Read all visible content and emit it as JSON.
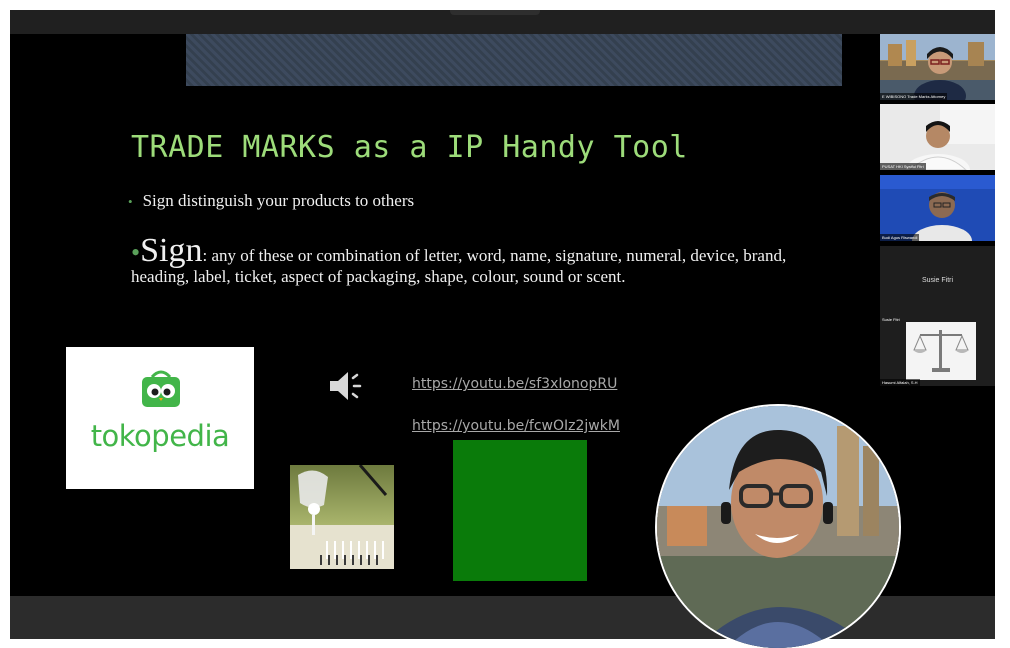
{
  "slide": {
    "title": "TRADE MARKS as a IP Handy Tool",
    "bullet1_marker": "•",
    "bullet1": "Sign distinguish your products to others",
    "bullet2_marker": "•",
    "bullet2_term": "Sign",
    "bullet2_text": ":  any of these or combination of  letter, word, name, signature, numeral, device, brand, heading, label, ticket, aspect of packaging, shape, colour, sound or scent.",
    "logo_text": "tokopedia",
    "link1": "https://youtu.be/sf3xIonopRU",
    "link2": "https://youtu.be/fcwOIz2jwkM",
    "audio_icon": "speaker-icon"
  },
  "participants": [
    {
      "label": "E WIBISONO Trade Marks Attorney"
    },
    {
      "label": "PUSAT HKI Syaiful Fitri"
    },
    {
      "label": "Budi Agus Riswandi"
    },
    {
      "label": "Susie Fitri",
      "center_name": "Susie Fitri"
    },
    {
      "label": "Hasumi Alfalah, S.H",
      "top_label": "Susie Fitri"
    }
  ],
  "colors": {
    "title": "#9ddc7a",
    "brand_green": "#42b549",
    "green_box": "#0a7b0a"
  }
}
